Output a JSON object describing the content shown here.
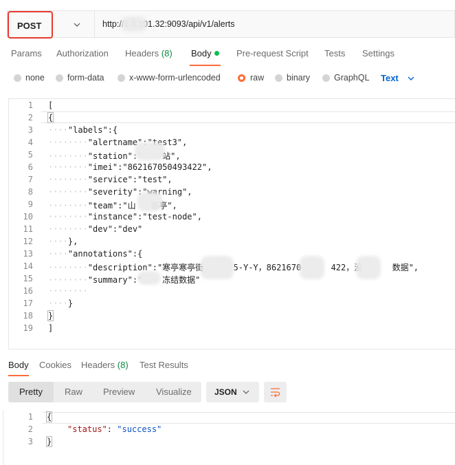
{
  "request": {
    "method": "POST",
    "url": "http://1       3.101.32:9093/api/v1/alerts"
  },
  "request_tabs": [
    {
      "label": "Params"
    },
    {
      "label": "Authorization"
    },
    {
      "label": "Headers",
      "count": "(8)"
    },
    {
      "label": "Body"
    },
    {
      "label": "Pre-request Script"
    },
    {
      "label": "Tests"
    },
    {
      "label": "Settings"
    }
  ],
  "body_types": [
    {
      "label": "none"
    },
    {
      "label": "form-data"
    },
    {
      "label": "x-www-form-urlencoded"
    },
    {
      "label": "raw"
    },
    {
      "label": "binary"
    },
    {
      "label": "GraphQL"
    }
  ],
  "raw_format": "Text",
  "editor": {
    "line_numbers": [
      "1",
      "2",
      "3",
      "4",
      "5",
      "6",
      "7",
      "8",
      "9",
      "10",
      "11",
      "12",
      "13",
      "14",
      "15",
      "16",
      "17",
      "18",
      "19"
    ],
    "lines": [
      {
        "indent": "",
        "text": "["
      },
      {
        "indent": "",
        "text": "{"
      },
      {
        "indent": "····",
        "text": "\"labels\":{"
      },
      {
        "indent": "········",
        "text": "\"alertname\":\"test3\","
      },
      {
        "indent": "········",
        "text": "\"station\":\"    站\","
      },
      {
        "indent": "········",
        "text": "\"imei\":\"862167050493422\","
      },
      {
        "indent": "········",
        "text": "\"service\":\"test\","
      },
      {
        "indent": "········",
        "text": "\"severity\":\"warning\","
      },
      {
        "indent": "········",
        "text": "\"team\":\"山   寨亭\","
      },
      {
        "indent": "········",
        "text": "\"instance\":\"test-node\","
      },
      {
        "indent": "········",
        "text": "\"dev\":\"dev\""
      },
      {
        "indent": "····",
        "text": "},"
      },
      {
        "indent": "····",
        "text": "\"annotations\":{"
      },
      {
        "indent": "········",
        "text": "\"description\":\"寒亭寒亭街      5-Y-Y，8621670      422，没      数据\","
      },
      {
        "indent": "········",
        "text": "\"summary\":\"    冻结数据\""
      },
      {
        "indent": "········",
        "text": ""
      },
      {
        "indent": "····",
        "text": "}"
      },
      {
        "indent": "",
        "text": "}"
      },
      {
        "indent": "",
        "text": "]"
      }
    ]
  },
  "response_tabs": [
    {
      "label": "Body"
    },
    {
      "label": "Cookies"
    },
    {
      "label": "Headers",
      "count": "(8)"
    },
    {
      "label": "Test Results"
    }
  ],
  "response_views": [
    "Pretty",
    "Raw",
    "Preview",
    "Visualize"
  ],
  "response_format": "JSON",
  "response_body": {
    "line_numbers": [
      "1",
      "2",
      "3"
    ],
    "open": "{",
    "key": "\"status\"",
    "colon": ": ",
    "value": "\"success\"",
    "close": "}"
  },
  "colors": {
    "accent": "#ff6c37",
    "method_highlight": "#e8382f",
    "link_blue": "#0265d2",
    "green_count": "#0b8a3e"
  }
}
